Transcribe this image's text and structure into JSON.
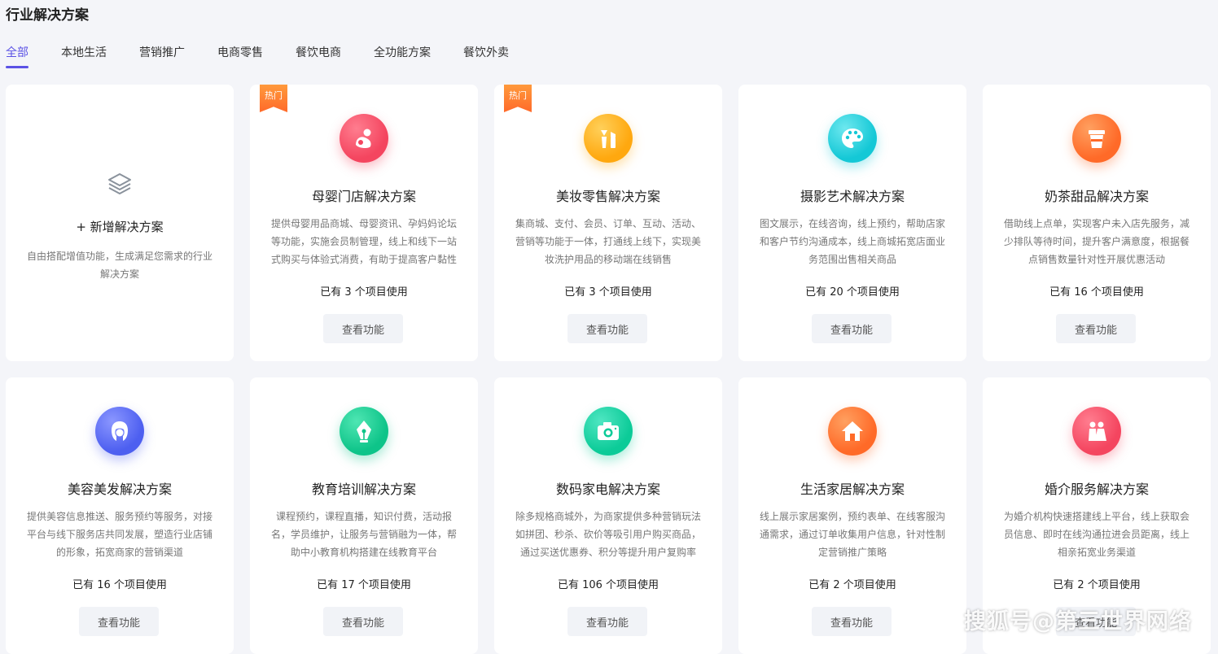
{
  "page": {
    "title": "行业解决方案"
  },
  "tabs": [
    {
      "label": "全部",
      "active": true
    },
    {
      "label": "本地生活"
    },
    {
      "label": "营销推广"
    },
    {
      "label": "电商零售"
    },
    {
      "label": "餐饮电商"
    },
    {
      "label": "全功能方案"
    },
    {
      "label": "餐饮外卖"
    }
  ],
  "add_card": {
    "icon": "layers-icon",
    "title": "+ 新增解决方案",
    "desc": "自由搭配增值功能，生成满足您需求的行业解决方案"
  },
  "cards": [
    {
      "name": "母婴门店解决方案",
      "hot": "热门",
      "icon": "mother-baby-icon",
      "color": "#f4455f",
      "desc": "提供母婴用品商城、母婴资讯、孕妈妈论坛等功能，实施会员制管理，线上和线下一站式购买与体验式消费，有助于提高客户黏性",
      "usage": "已有 3 个项目使用",
      "button": "查看功能"
    },
    {
      "name": "美妆零售解决方案",
      "hot": "热门",
      "icon": "makeup-icon",
      "color": "#ffb119",
      "desc": "集商城、支付、会员、订单、互动、活动、营销等功能于一体，打通线上线下，实现美妆洗护用品的移动端在线销售",
      "usage": "已有 3 个项目使用",
      "button": "查看功能"
    },
    {
      "name": "摄影艺术解决方案",
      "icon": "palette-icon",
      "color": "#1fd2de",
      "desc": "图文展示，在线咨询，线上预约，帮助店家和客户节约沟通成本，线上商城拓宽店面业务范围出售相关商品",
      "usage": "已有 20 个项目使用",
      "button": "查看功能"
    },
    {
      "name": "奶茶甜品解决方案",
      "icon": "cup-icon",
      "color": "#ff7a32",
      "desc": "借助线上点单，实现客户未入店先服务，减少排队等待时间，提升客户满意度，根据餐点销售数量针对性开展优惠活动",
      "usage": "已有 16 个项目使用",
      "button": "查看功能"
    },
    {
      "name": "美容美发解决方案",
      "icon": "hair-icon",
      "color": "#5b6ef5",
      "desc": "提供美容信息推送、服务预约等服务，对接平台与线下服务店共同发展，塑造行业店铺的形象，拓宽商家的营销渠道",
      "usage": "已有 16 个项目使用",
      "button": "查看功能"
    },
    {
      "name": "教育培训解决方案",
      "icon": "pen-nib-icon",
      "color": "#10cf92",
      "desc": "课程预约，课程直播，知识付费，活动报名，学员维护，让服务与营销融为一体，帮助中小教育机构搭建在线教育平台",
      "usage": "已有 17 个项目使用",
      "button": "查看功能"
    },
    {
      "name": "数码家电解决方案",
      "icon": "camera-icon",
      "color": "#12d1a0",
      "desc": "除多规格商城外，为商家提供多种营销玩法如拼团、秒杀、砍价等吸引用户购买商品，通过买送优惠券、积分等提升用户复购率",
      "usage": "已有 106 个项目使用",
      "button": "查看功能"
    },
    {
      "name": "生活家居解决方案",
      "icon": "house-icon",
      "color": "#ff7a32",
      "desc": "线上展示家居案例，预约表单、在线客服沟通需求，通过订单收集用户信息，针对性制定营销推广策略",
      "usage": "已有 2 个项目使用",
      "button": "查看功能"
    },
    {
      "name": "婚介服务解决方案",
      "icon": "couple-icon",
      "color": "#f4455f",
      "desc": "为婚介机构快速搭建线上平台，线上获取会员信息、即时在线沟通拉进会员距离，线上相亲拓宽业务渠道",
      "usage": "已有 2 个项目使用",
      "button": "查看功能"
    }
  ],
  "watermark": "搜狐号@第三世界网络"
}
